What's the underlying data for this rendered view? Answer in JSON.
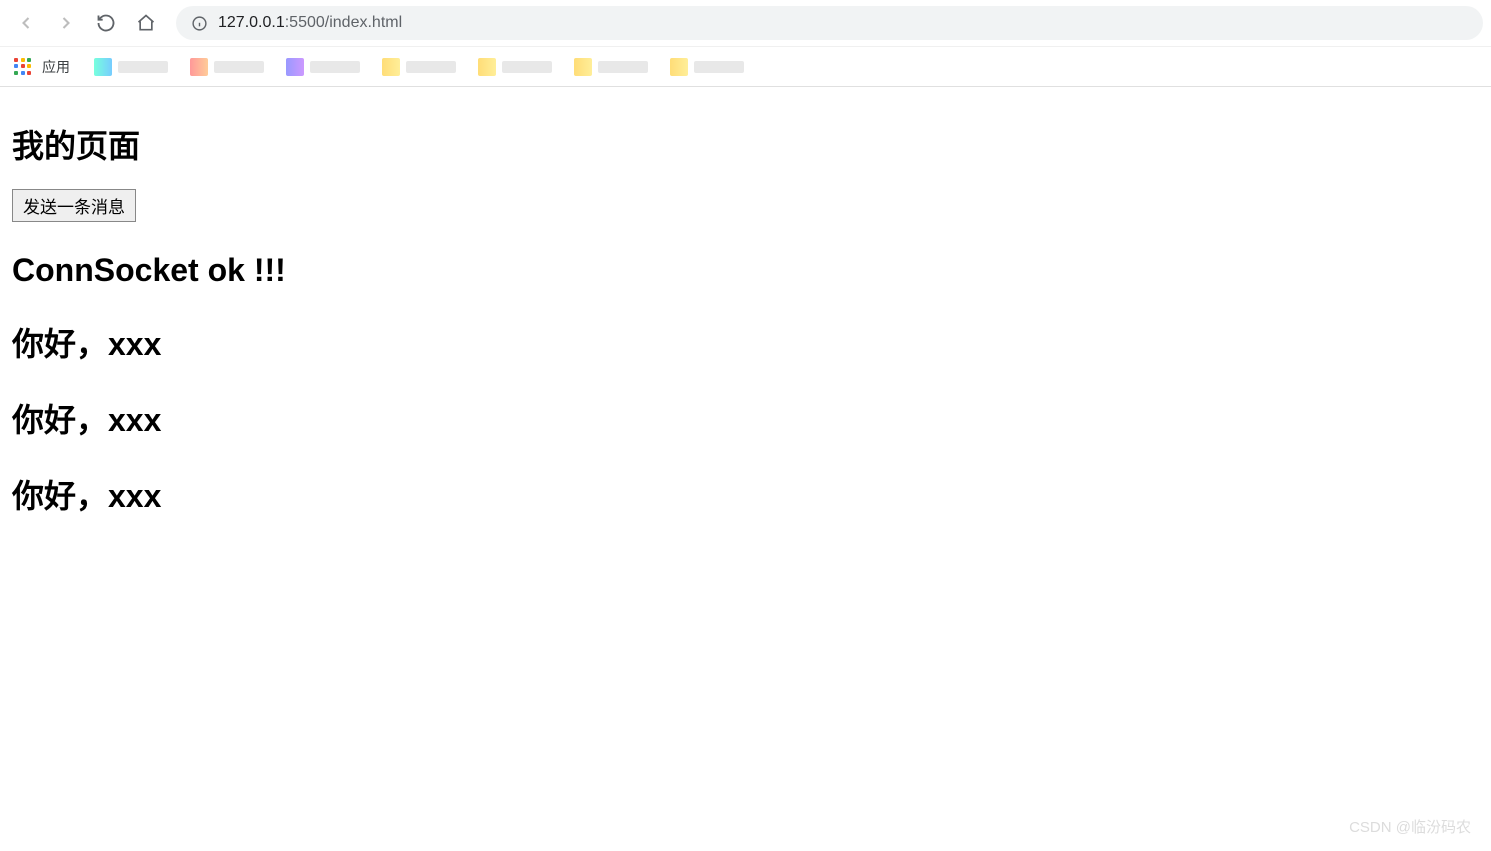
{
  "browser": {
    "url_host": "127.0.0.1",
    "url_port": ":5500",
    "url_path": "/index.html",
    "apps_label": "应用"
  },
  "page": {
    "title": "我的页面",
    "send_button_label": "发送一条消息",
    "messages": [
      "ConnSocket ok !!!",
      "你好，xxx",
      "你好，xxx",
      "你好，xxx"
    ]
  },
  "watermark": "CSDN @临汾码农"
}
